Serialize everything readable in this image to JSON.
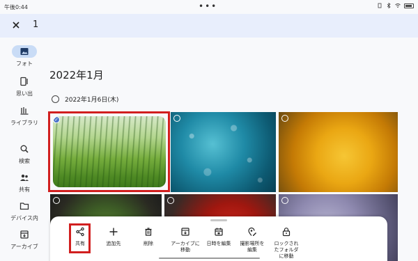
{
  "status_bar": {
    "time": "午後0:44",
    "center_dots": "•••"
  },
  "selection_bar": {
    "close_icon": "close-icon",
    "selected_count": "1"
  },
  "nav": {
    "items": [
      {
        "label": "フォト",
        "icon": "photo-icon",
        "active": true
      },
      {
        "label": "思い出",
        "icon": "memories-icon"
      },
      {
        "label": "ライブラリ",
        "icon": "library-icon"
      },
      {
        "label": "検索",
        "icon": "search-icon"
      },
      {
        "label": "共有",
        "icon": "sharing-icon"
      },
      {
        "label": "デバイス内",
        "icon": "folder-icon"
      },
      {
        "label": "アーカイブ",
        "icon": "archive-icon"
      }
    ]
  },
  "main": {
    "month_heading": "2022年1月",
    "day_heading": "2022年1月6日(木)",
    "photos": [
      {
        "name": "photo-grass",
        "selected": true
      },
      {
        "name": "photo-water-bubbles",
        "selected": false
      },
      {
        "name": "photo-yellow-rose",
        "selected": false
      },
      {
        "name": "photo-salad",
        "selected": false
      },
      {
        "name": "photo-strawberries",
        "selected": false
      },
      {
        "name": "photo-bokeh",
        "selected": false
      }
    ]
  },
  "actions": {
    "share": "共有",
    "add_to": "追加先",
    "delete": "削除",
    "archive_line1": "アーカイブに",
    "archive_line2": "移動",
    "edit_date": "日時を編集",
    "edit_location_line1": "撮影場所を",
    "edit_location_line2": "編集",
    "locked_line1": "ロックされ",
    "locked_line2": "たフォルダ",
    "locked_line3": "に移動"
  },
  "colors": {
    "accent": "#c9dcf6",
    "highlight": "#d11f1f",
    "selection_bar": "#e8eefc"
  }
}
